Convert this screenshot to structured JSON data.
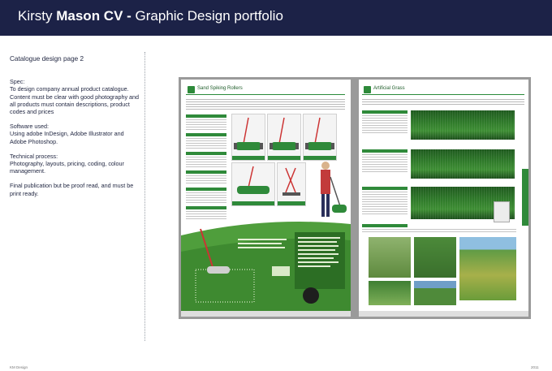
{
  "header": {
    "name_first": "Kirsty ",
    "name_bold": "Mason CV - ",
    "subtitle": "Graphic Design portfolio",
    "bg_color": "#1c2247"
  },
  "left": {
    "heading": "Catalogue design page 2",
    "spec_label": "Spec:",
    "spec_text": "To design company annual product catalogue. Content must be clear with good photography and all products must contain descriptions, product codes and prices",
    "software_label": "Software used:",
    "software_text": "Using adobe InDesign, Adobe Illustrator and Adobe Photoshop.",
    "process_label": "Technical process:",
    "process_text": "Photography, layouts, pricing, coding, colour management.",
    "final_text": "Final publication but be proof read, and must be print ready."
  },
  "spread": {
    "left_page_title": "Sand Spiking Rollers",
    "right_page_title": "Artificial Grass"
  },
  "footer": {
    "left": "KM Design",
    "right": "2011"
  }
}
